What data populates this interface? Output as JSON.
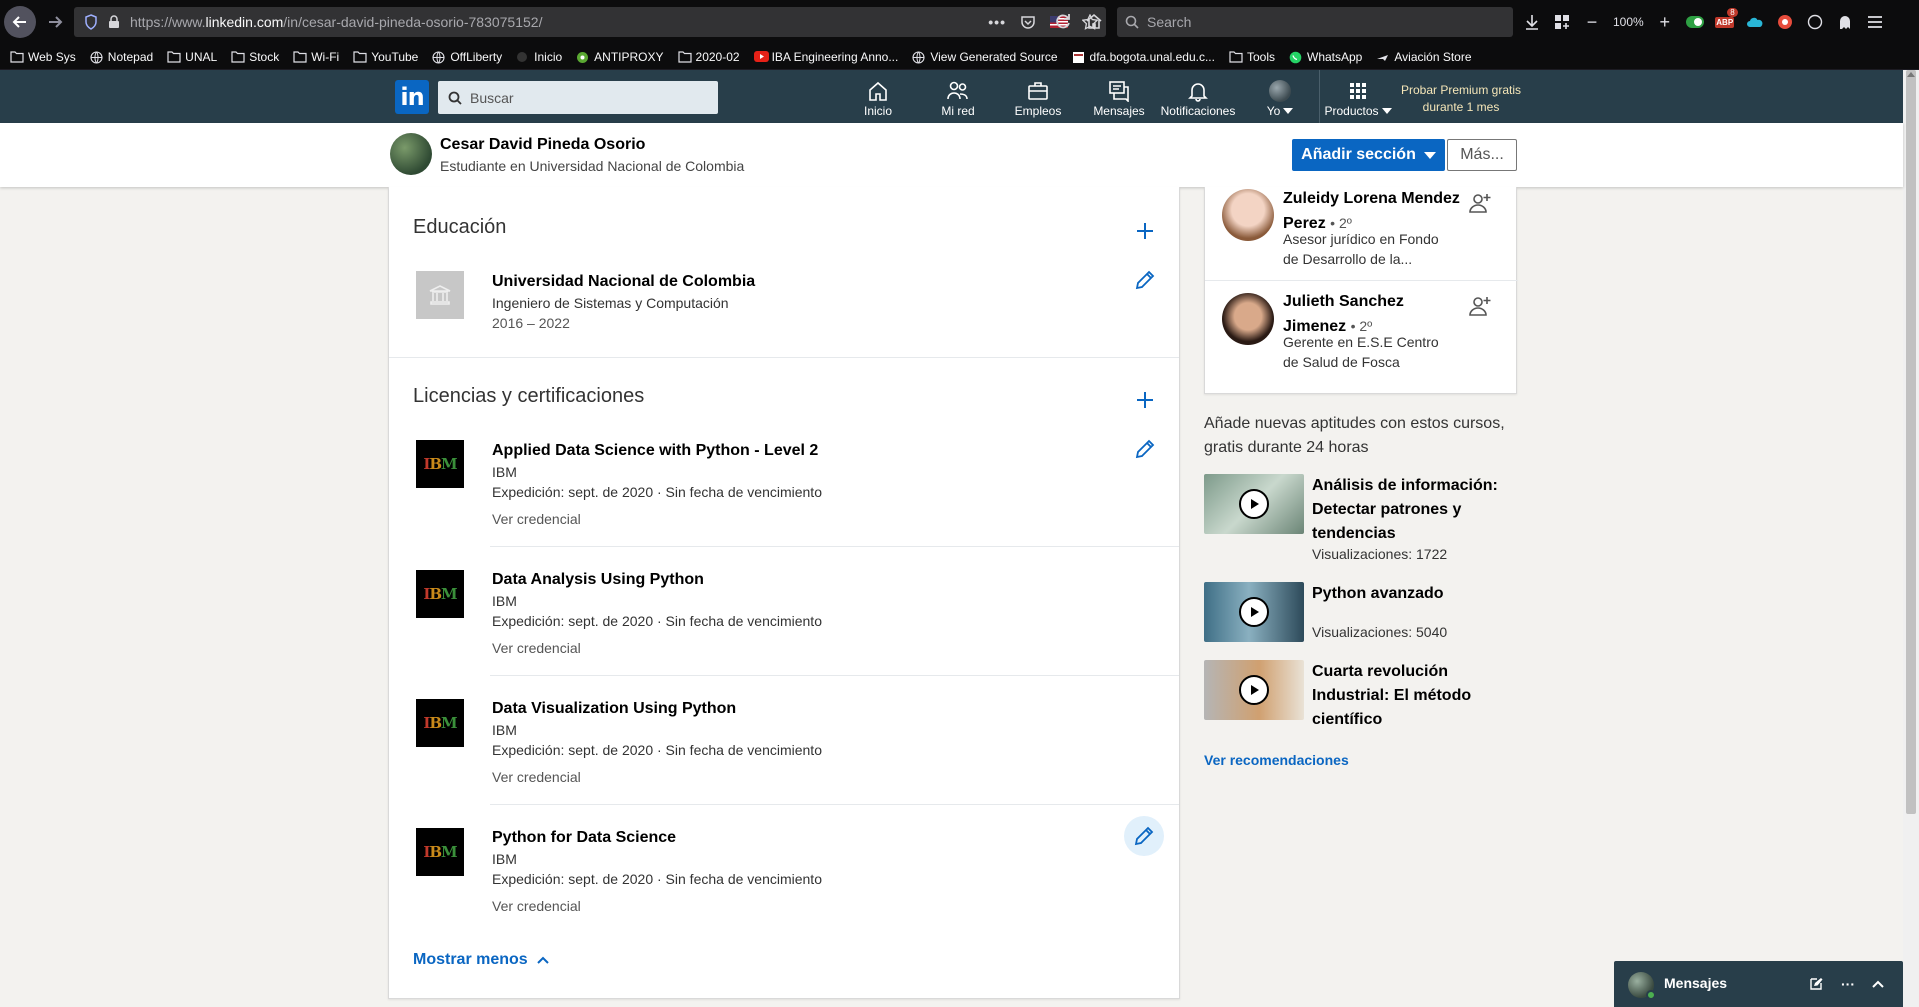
{
  "browser": {
    "url_prefix": "https://www.",
    "url_domain": "linkedin.com",
    "url_path": "/in/cesar-david-pineda-osorio-783075152/",
    "search_placeholder": "Search",
    "zoom": "100%",
    "abp_badge": "8",
    "bookmarks": [
      {
        "label": "Web Sys",
        "icon": "folder-icon"
      },
      {
        "label": "Notepad",
        "icon": "globe-icon"
      },
      {
        "label": "UNAL",
        "icon": "folder-icon"
      },
      {
        "label": "Stock",
        "icon": "folder-icon"
      },
      {
        "label": "Wi-Fi",
        "icon": "folder-icon"
      },
      {
        "label": "YouTube",
        "icon": "folder-icon"
      },
      {
        "label": "OffLiberty",
        "icon": "globe-icon"
      },
      {
        "label": "Inicio",
        "icon": "dark-icon"
      },
      {
        "label": "ANTIPROXY",
        "icon": "green-circle-icon"
      },
      {
        "label": "2020-02",
        "icon": "folder-icon"
      },
      {
        "label": "IBA Engineering Anno...",
        "icon": "youtube-icon"
      },
      {
        "label": "View Generated Source",
        "icon": "globe-icon"
      },
      {
        "label": "dfa.bogota.unal.edu.c...",
        "icon": "page-icon"
      },
      {
        "label": "Tools",
        "icon": "folder-icon"
      },
      {
        "label": "WhatsApp",
        "icon": "whatsapp-icon"
      },
      {
        "label": "Aviación Store",
        "icon": "plane-icon"
      }
    ]
  },
  "linkedin_header": {
    "logo": "in",
    "search_placeholder": "Buscar",
    "nav": [
      {
        "label": "Inicio",
        "icon": "home-icon"
      },
      {
        "label": "Mi red",
        "icon": "network-icon"
      },
      {
        "label": "Empleos",
        "icon": "briefcase-icon"
      },
      {
        "label": "Mensajes",
        "icon": "messages-icon"
      },
      {
        "label": "Notificaciones",
        "icon": "bell-icon"
      },
      {
        "label": "Yo",
        "icon": "avatar"
      },
      {
        "label": "Productos",
        "icon": "grid-icon"
      }
    ],
    "premium_line1": "Probar Premium gratis",
    "premium_line2": "durante 1 mes"
  },
  "profile_bar": {
    "name": "Cesar David Pineda Osorio",
    "headline": "Estudiante en Universidad Nacional de Colombia",
    "add_section": "Añadir sección",
    "more": "Más..."
  },
  "education": {
    "title": "Educación",
    "items": [
      {
        "school": "Universidad Nacional de Colombia",
        "degree": "Ingeniero de Sistemas y Computación",
        "dates": "2016 – 2022"
      }
    ]
  },
  "licenses": {
    "title": "Licencias y certificaciones",
    "items": [
      {
        "name": "Applied Data Science with Python - Level 2",
        "issuer": "IBM",
        "issued": "Expedición: sept. de 2020 · Sin fecha de vencimiento",
        "credential": "Ver credencial"
      },
      {
        "name": "Data Analysis Using Python",
        "issuer": "IBM",
        "issued": "Expedición: sept. de 2020 · Sin fecha de vencimiento",
        "credential": "Ver credencial"
      },
      {
        "name": "Data Visualization Using Python",
        "issuer": "IBM",
        "issued": "Expedición: sept. de 2020 · Sin fecha de vencimiento",
        "credential": "Ver credencial"
      },
      {
        "name": "Python for Data Science",
        "issuer": "IBM",
        "issued": "Expedición: sept. de 2020 · Sin fecha de vencimiento",
        "credential": "Ver credencial"
      }
    ],
    "show_less": "Mostrar menos",
    "logo_letters": [
      "I",
      "B",
      "M"
    ]
  },
  "people": [
    {
      "name": "Zuleidy Lorena Mendez Perez",
      "degree": "• 2º",
      "desc": "Asesor jurídico en Fondo de Desarrollo de la..."
    },
    {
      "name": "Julieth Sanchez Jimenez",
      "degree": "• 2º",
      "desc": "Gerente en E.S.E Centro de Salud de Fosca"
    }
  ],
  "courses": {
    "heading": "Añade nuevas aptitudes con estos cursos, gratis durante 24 horas",
    "items": [
      {
        "title": "Análisis de información: Detectar patrones y tendencias",
        "views": "Visualizaciones: 1722"
      },
      {
        "title": "Python avanzado",
        "views": "Visualizaciones: 5040"
      },
      {
        "title": "Cuarta revolución Industrial: El método científico",
        "views": ""
      }
    ],
    "see_more": "Ver recomendaciones"
  },
  "messaging": {
    "label": "Mensajes"
  },
  "colors": {
    "linkedin_blue": "#0a66c2",
    "header_bg": "#283e4a",
    "browser_bg": "#0c0c0d"
  }
}
